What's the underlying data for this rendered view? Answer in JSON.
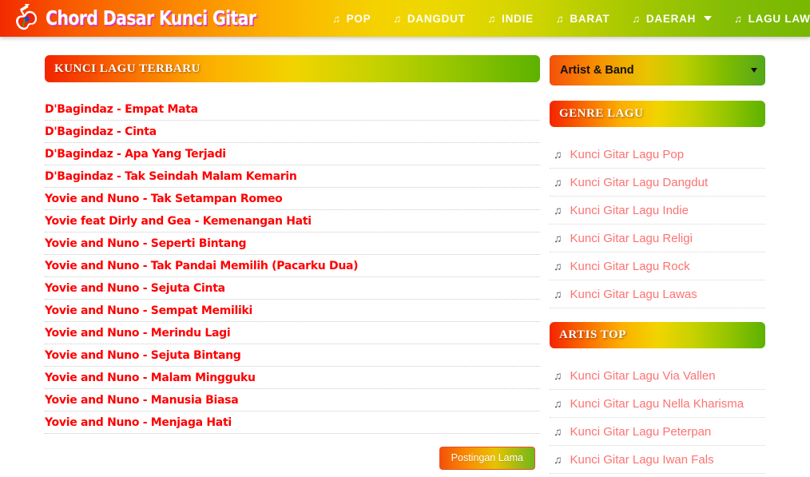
{
  "header": {
    "logo_text": "Chord Dasar Kunci Gitar",
    "logo_icon": "guitar-icon",
    "search_icon": "search-icon",
    "nav_items": [
      {
        "label": "POP",
        "icon": "music-note-icon",
        "has_caret": false
      },
      {
        "label": "DANGDUT",
        "icon": "music-note-icon",
        "has_caret": false
      },
      {
        "label": "INDIE",
        "icon": "music-note-icon",
        "has_caret": false
      },
      {
        "label": "BARAT",
        "icon": "music-note-icon",
        "has_caret": false
      },
      {
        "label": "DAERAH",
        "icon": "music-note-icon",
        "has_caret": true
      },
      {
        "label": "LAGU LAWAS",
        "icon": "music-note-icon",
        "has_caret": false
      }
    ]
  },
  "content": {
    "heading": "KUNCI LAGU TERBARU",
    "songs": [
      "D'Bagindaz - Empat Mata",
      "D'Bagindaz - Cinta",
      "D'Bagindaz - Apa Yang Terjadi",
      "D'Bagindaz - Tak Seindah Malam Kemarin",
      "Yovie and Nuno - Tak Setampan Romeo",
      "Yovie feat Dirly and Gea - Kemenangan Hati",
      "Yovie and Nuno - Seperti Bintang",
      "Yovie and Nuno - Tak Pandai Memilih (Pacarku Dua)",
      "Yovie and Nuno - Sejuta Cinta",
      "Yovie and Nuno - Sempat Memiliki",
      "Yovie and Nuno - Merindu Lagi",
      "Yovie and Nuno - Sejuta Bintang",
      "Yovie and Nuno - Malam Mingguku",
      "Yovie and Nuno - Manusia Biasa",
      "Yovie and Nuno - Menjaga Hati"
    ],
    "older_posts_label": "Postingan Lama"
  },
  "sidebar": {
    "artist_select_value": "Artist & Band",
    "genre_heading": "GENRE LAGU",
    "genre_items": [
      "Kunci Gitar Lagu Pop",
      "Kunci Gitar Lagu Dangdut",
      "Kunci Gitar Lagu Indie",
      "Kunci Gitar Lagu Religi",
      "Kunci Gitar Lagu Rock",
      "Kunci Gitar Lagu Lawas"
    ],
    "artist_heading": "ARTIS TOP",
    "artist_items": [
      "Kunci Gitar Lagu Via Vallen",
      "Kunci Gitar Lagu Nella Kharisma",
      "Kunci Gitar Lagu Peterpan",
      "Kunci Gitar Lagu Iwan Fals"
    ]
  },
  "colors": {
    "gradient_start": "#f42400",
    "gradient_mid": "#f2d400",
    "gradient_end": "#78b800",
    "song_link": "#ff0000",
    "sidebar_link": "#fd7272",
    "logo_shadow": "#e040c8"
  }
}
